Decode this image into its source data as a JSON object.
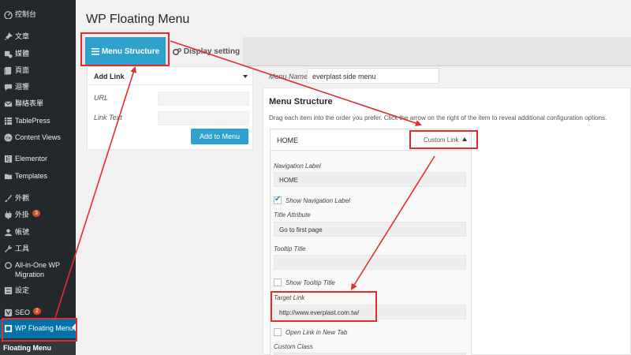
{
  "sidebar": {
    "items": [
      {
        "label": "控制台",
        "icon": "dashboard-icon"
      },
      {
        "label": "文章",
        "icon": "pin-icon"
      },
      {
        "label": "媒體",
        "icon": "media-icon"
      },
      {
        "label": "頁面",
        "icon": "page-icon"
      },
      {
        "label": "迴響",
        "icon": "comment-icon"
      },
      {
        "label": "聯絡表單",
        "icon": "mail-icon"
      },
      {
        "label": "TablePress",
        "icon": "table-icon"
      },
      {
        "label": "Content Views",
        "icon": "cv-icon"
      },
      {
        "label": "Elementor",
        "icon": "elementor-icon"
      },
      {
        "label": "Templates",
        "icon": "folder-icon"
      },
      {
        "label": "外觀",
        "icon": "brush-icon"
      },
      {
        "label": "外掛",
        "icon": "plugin-icon",
        "badge": "3"
      },
      {
        "label": "帳號",
        "icon": "user-icon"
      },
      {
        "label": "工具",
        "icon": "wrench-icon"
      },
      {
        "label": "All-in-One WP Migration",
        "icon": "migration-icon"
      },
      {
        "label": "設定",
        "icon": "settings-icon"
      },
      {
        "label": "SEO",
        "icon": "yoast-icon",
        "badge": "2"
      },
      {
        "label": "WP Floating Menu",
        "icon": "floating-menu-icon"
      }
    ],
    "submenu_label": "Floating Menu"
  },
  "page": {
    "title": "WP Floating Menu"
  },
  "tabs": {
    "menu_structure": "Menu Structure",
    "display_setting": "Display setting"
  },
  "add_link": {
    "title": "Add Link",
    "url_label": "URL",
    "url_value": "",
    "text_label": "Link Text",
    "text_value": "",
    "button": "Add to Menu"
  },
  "menu_name": {
    "label": "Menu Name",
    "value": "everplast side menu"
  },
  "structure": {
    "title": "Menu Structure",
    "description": "Drag each item into the order you prefer. Click the arrow on the right of the item to reveal additional configuration options."
  },
  "menu_item": {
    "title": "HOME",
    "type": "Custom Link",
    "nav_label_label": "Navigation Label",
    "nav_label_value": "HOME",
    "show_nav_label": "Show Navigation Label",
    "title_attr_label": "Title Attribute",
    "title_attr_value": "Go to first page",
    "tooltip_label": "Tooltip Title",
    "tooltip_value": "",
    "show_tooltip": "Show Tooltip Title",
    "target_link_label": "Target Link",
    "target_link_value": "http://www.everplast.com.tw/",
    "open_new_tab": "Open Link in New Tab",
    "custom_class_label": "Custom Class"
  },
  "colors": {
    "accent": "#2ea2cc",
    "sidebar": "#23282d",
    "annotation": "#e52b2b",
    "badge": "#d54e21"
  }
}
